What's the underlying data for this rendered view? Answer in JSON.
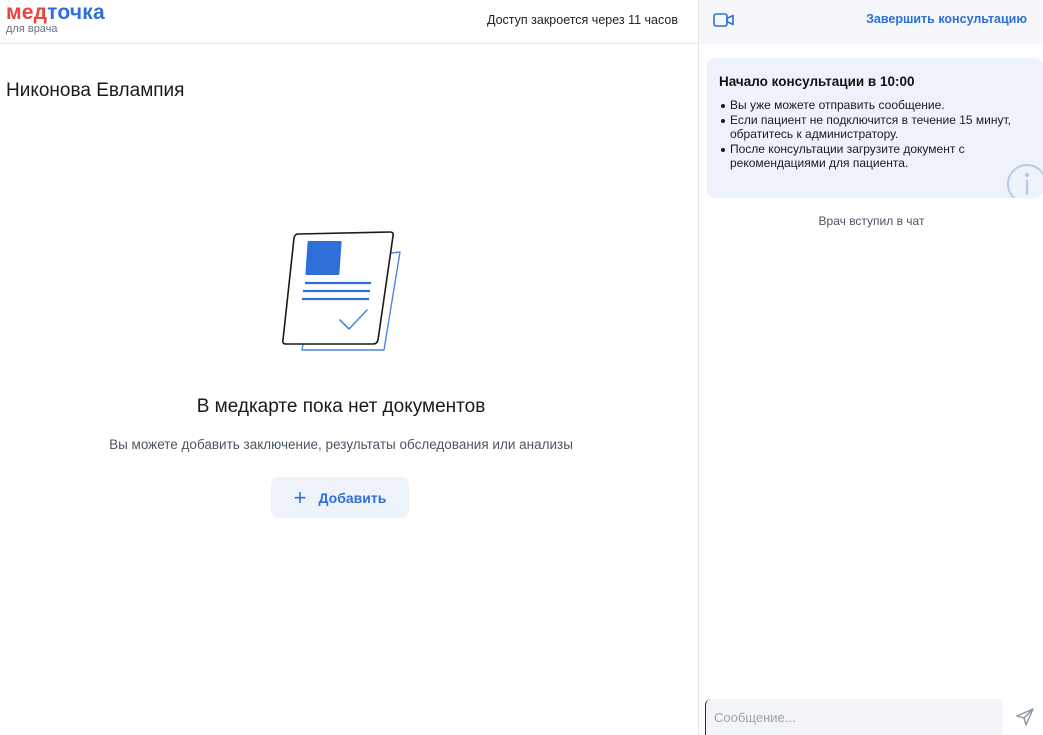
{
  "logo": {
    "part1": "мед",
    "part2": "точка",
    "subtitle": "для врача"
  },
  "topbar": {
    "access_notice": "Доступ закроется через 11 часов"
  },
  "patient": {
    "name": "Никонова Евлампия"
  },
  "documents": {
    "illustration_icon": "document-check-icon",
    "empty_title": "В медкарте пока нет документов",
    "empty_subtitle": "Вы можете добавить заключение, результаты обследования или анализы",
    "add_button_label": "Добавить",
    "add_button_icon": "plus-icon"
  },
  "chat": {
    "video_icon": "video-camera-icon",
    "finish_button_label": "Завершить консультацию",
    "info_card": {
      "title": "Начало консультации в 10:00",
      "items": [
        "Вы уже можете отправить сообщение.",
        "Если пациент не подключится в течение 15 минут, обратитесь к администратору.",
        "После консультации загрузите документ с рекомендациями для пациента."
      ],
      "icon": "info-icon"
    },
    "system_message": "Врач вступил в чат",
    "composer": {
      "placeholder": "Сообщение...",
      "value": ""
    },
    "send_icon": "send-icon"
  },
  "colors": {
    "brand_red": "#e8453c",
    "brand_blue": "#2e6fd8",
    "panel_bg": "#f5f7fb",
    "info_bg": "#eef3fb"
  }
}
